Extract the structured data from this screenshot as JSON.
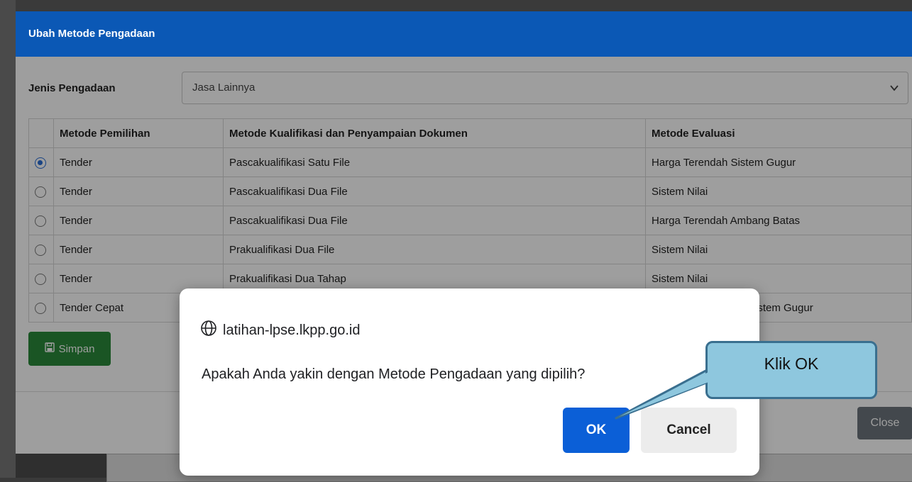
{
  "modal": {
    "title": "Ubah Metode Pengadaan",
    "jenis_label": "Jenis Pengadaan",
    "jenis_value": "Jasa Lainnya",
    "columns": [
      "Metode Pemilihan",
      "Metode Kualifikasi dan Penyampaian Dokumen",
      "Metode Evaluasi"
    ],
    "rows": [
      {
        "selected": true,
        "pemilihan": "Tender",
        "kualifikasi": "Pascakualifikasi Satu File",
        "evaluasi": "Harga Terendah Sistem Gugur"
      },
      {
        "selected": false,
        "pemilihan": "Tender",
        "kualifikasi": "Pascakualifikasi Dua File",
        "evaluasi": "Sistem Nilai"
      },
      {
        "selected": false,
        "pemilihan": "Tender",
        "kualifikasi": "Pascakualifikasi Dua File",
        "evaluasi": "Harga Terendah Ambang Batas"
      },
      {
        "selected": false,
        "pemilihan": "Tender",
        "kualifikasi": "Prakualifikasi Dua File",
        "evaluasi": "Sistem Nilai"
      },
      {
        "selected": false,
        "pemilihan": "Tender",
        "kualifikasi": "Prakualifikasi Dua Tahap",
        "evaluasi": "Sistem Nilai"
      },
      {
        "selected": false,
        "pemilihan": "Tender Cepat",
        "kualifikasi": "",
        "evaluasi": "Sistem Gugur"
      }
    ],
    "save_label": "Simpan",
    "close_label": "Close"
  },
  "confirm": {
    "origin": "latihan-lpse.lkpp.go.id",
    "message": "Apakah Anda yakin dengan Metode Pengadaan yang dipilih?",
    "ok_label": "OK",
    "cancel_label": "Cancel"
  },
  "callout": {
    "text": "Klik OK"
  },
  "icons": {
    "save": "floppy-disk-icon",
    "origin": "globe-icon",
    "dropdown": "chevron-down-icon"
  },
  "colors": {
    "header": "#0b58b5",
    "ok_button": "#0b5fd7",
    "save_button": "#2a8a3b",
    "callout_fill": "#8ec7de"
  }
}
